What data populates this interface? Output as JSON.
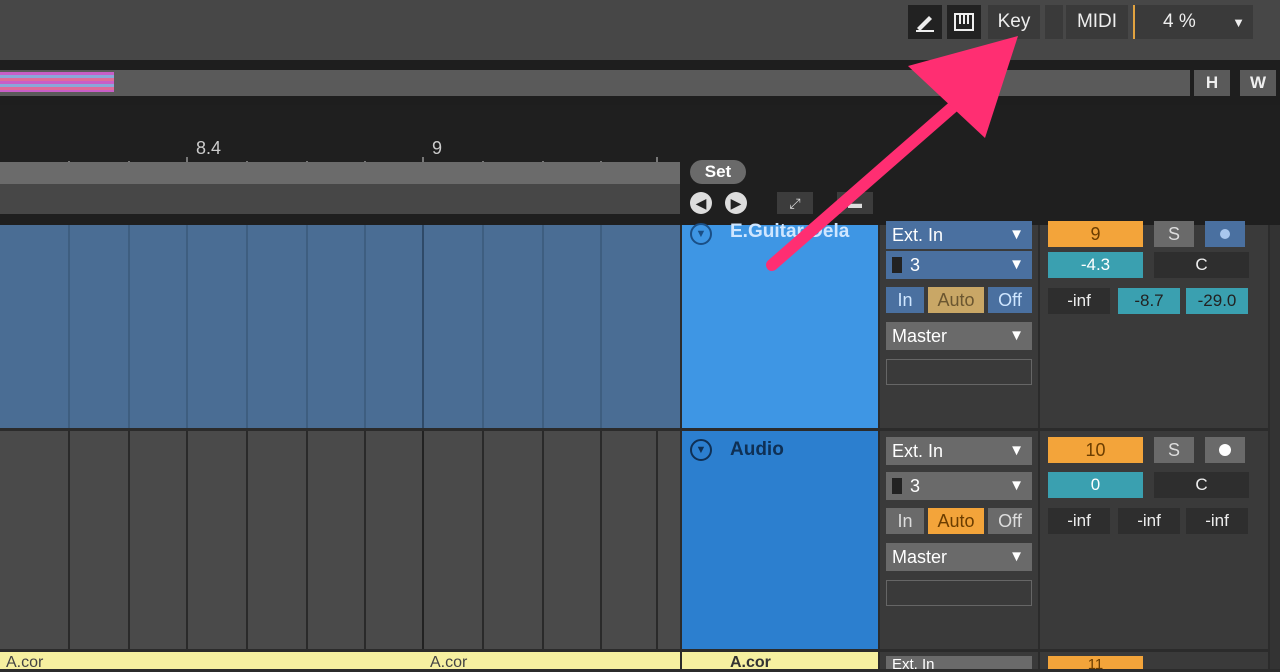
{
  "toolbar": {
    "draw_icon": "pencil-icon",
    "keyboard_icon": "piano-icon",
    "key_label": "Key",
    "midi_label": "MIDI",
    "cpu_label": "4 %"
  },
  "overview": {
    "h_label": "H",
    "w_label": "W"
  },
  "ruler": {
    "labels": [
      "8.4",
      "9"
    ]
  },
  "set_label": "Set",
  "tracks": [
    {
      "name": "E.Guitar Dela",
      "input_type": "Ext. In",
      "input_channel": "3",
      "monitor": [
        "In",
        "Auto",
        "Off"
      ],
      "output": "Master",
      "number": "9",
      "solo": "S",
      "volume": "-4.3",
      "pan": "C",
      "meters": [
        "-inf",
        "-8.7",
        "-29.0"
      ]
    },
    {
      "name": "Audio",
      "input_type": "Ext. In",
      "input_channel": "3",
      "monitor": [
        "In",
        "Auto",
        "Off"
      ],
      "output": "Master",
      "number": "10",
      "solo": "S",
      "volume": "0",
      "pan": "C",
      "meters": [
        "-inf",
        "-inf",
        "-inf"
      ]
    },
    {
      "name": "A.cor",
      "input_type": "Ext. In",
      "number": "11",
      "clips": [
        "A.cor",
        "A.cor"
      ]
    }
  ],
  "colors": {
    "accent": "#f5a623",
    "arrow": "#ff2e72",
    "track1": "#3e96e4",
    "track2": "#2c7fcf",
    "clip_yellow": "#f6f0a0"
  }
}
